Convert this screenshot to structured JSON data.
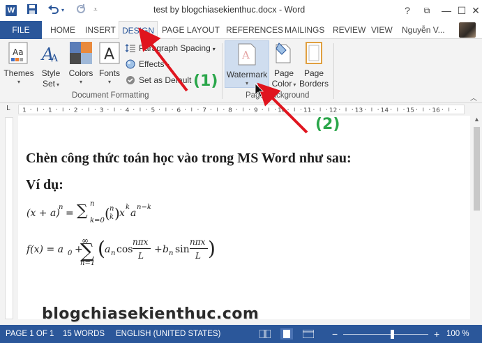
{
  "titlebar": {
    "app_logo": "W",
    "save_icon": "save-icon",
    "undo_icon": "undo-icon",
    "redo_icon": "redo-icon",
    "title": "test by blogchiasekienthuc.docx - Word",
    "help": "?",
    "ribbon_display": "⧉",
    "minimize": "—",
    "restore": "☐",
    "close": "✕"
  },
  "tabs": {
    "file": "FILE",
    "items": [
      "HOME",
      "INSERT",
      "DESIGN",
      "PAGE LAYOUT",
      "REFERENCES",
      "MAILINGS",
      "REVIEW",
      "VIEW"
    ],
    "active": "DESIGN",
    "user": "Nguyễn V..."
  },
  "ribbon": {
    "document_formatting": {
      "label": "Document Formatting",
      "themes": "Themes",
      "style_set_1": "Style",
      "style_set_2": "Set",
      "colors": "Colors",
      "fonts": "Fonts",
      "paragraph_spacing": "Paragraph Spacing",
      "effects": "Effects",
      "set_as_default": "Set as Default"
    },
    "page_background": {
      "label": "Page Background",
      "watermark": "Watermark",
      "page_color_1": "Page",
      "page_color_2": "Color",
      "page_borders_1": "Page",
      "page_borders_2": "Borders"
    }
  },
  "ruler": {
    "numbers": [
      "1",
      "1",
      "2",
      "3",
      "4",
      "5",
      "6",
      "7",
      "8",
      "9",
      "10",
      "11",
      "12",
      "13",
      "14",
      "15",
      "16"
    ]
  },
  "document": {
    "heading": "Chèn công thức toán học vào trong MS Word như sau:",
    "subheading": "Ví dụ:",
    "formula1": {
      "lhs": "(x + a)",
      "lhs_exp": "n",
      "eq": "=",
      "sum": "∑",
      "sum_top": "n",
      "sum_bottom": "k=0",
      "binom_top": "n",
      "binom_bottom": "k",
      "x": "x",
      "x_exp": "k",
      "a": "a",
      "a_exp": "n−k"
    },
    "formula2": {
      "lhs": "f(x) = a",
      "a0_sub": "0",
      "plus": "+",
      "sum": "∑",
      "sum_top": "∞",
      "sum_bottom": "n=1",
      "lparen": "(",
      "an": "a",
      "an_sub": "n",
      "cos": "cos",
      "frac1_num": "nπx",
      "frac1_den": "L",
      "plus2": "+",
      "bn": "b",
      "bn_sub": "n",
      "sin": "sin",
      "frac2_num": "nπx",
      "frac2_den": "L",
      "rparen": ")"
    },
    "watermark_text": "blogchiasekienthuc.com"
  },
  "statusbar": {
    "page": "PAGE 1 OF 1",
    "words": "15 WORDS",
    "language": "ENGLISH (UNITED STATES)",
    "zoom_out": "−",
    "zoom_in": "+",
    "zoom": "100 %",
    "zoom_level": 1.0
  },
  "annotations": {
    "step1": "(1)",
    "step2": "(2)",
    "arrow_color": "#e0141e",
    "step_color": "#2aa64a"
  },
  "colors": {
    "accent": "#2b579a"
  }
}
